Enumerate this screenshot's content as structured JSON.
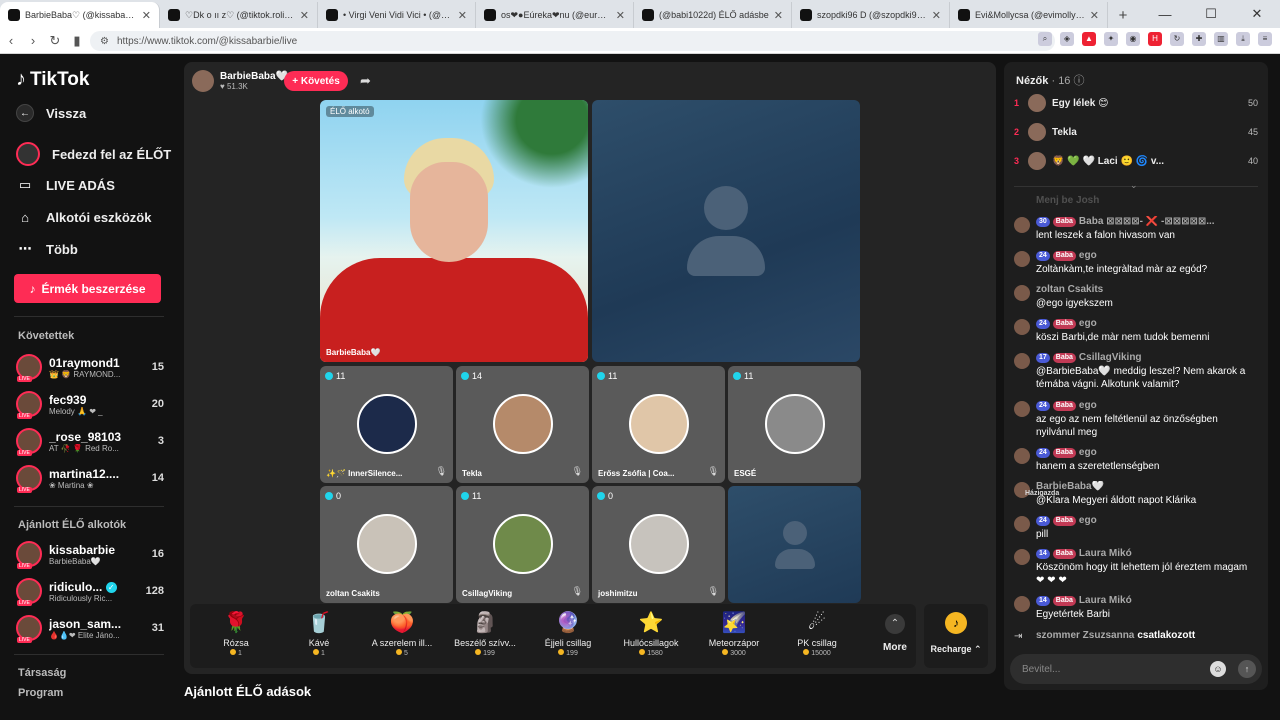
{
  "browser": {
    "tabs": [
      {
        "title": "BarbieBaba♡ (@kissabarbie",
        "active": true
      },
      {
        "title": "♡Dk o ıı z♡ (@tiktok.roli) ÉLŐ adás",
        "active": false
      },
      {
        "title": "• Virgi Veni Vidi Vici • (@virgiveni",
        "active": false
      },
      {
        "title": "os❤●Eúreka❤nu (@eurekaeurs",
        "active": false
      },
      {
        "title": "(@babi1022d) ÉLŐ adásbe",
        "active": false
      },
      {
        "title": "szopdki96 D (@szopdki96) ÉLŐ adás",
        "active": false
      },
      {
        "title": "Evi&Mollycsa (@evimolly2) ÉLŐ adás",
        "active": false
      }
    ],
    "url": "https://www.tiktok.com/@kissabarbie/live"
  },
  "sidebar": {
    "logo": "TikTok",
    "back": "Vissza",
    "explore": "Fedezd fel az ÉLŐT",
    "live": "LIVE ADÁS",
    "creator_tools": "Alkotói eszközök",
    "more": "Több",
    "coins_button": "Érmék beszerzése",
    "following_title": "Követettek",
    "following": [
      {
        "name": "01raymond1",
        "sub": "👑 🦁 RAYMOND...",
        "count": "15"
      },
      {
        "name": "fec939",
        "sub": "Melody 🙏 ❤ _",
        "count": "20"
      },
      {
        "name": "_rose_98103",
        "sub": "AT 🥀 🌹 Red Ro...",
        "count": "3"
      },
      {
        "name": "martina12....",
        "sub": "❀ Martina ❀",
        "count": "14"
      }
    ],
    "recommended_title": "Ajánlott ÉLŐ alkotók",
    "recommended": [
      {
        "name": "kissabarbie",
        "sub": "BarbieBaba🤍",
        "count": "16",
        "verified": false
      },
      {
        "name": "ridiculo...",
        "sub": "Ridiculously Ric...",
        "count": "128",
        "verified": true
      },
      {
        "name": "jason_sam...",
        "sub": "🩸💧❤ Elite Jáno...",
        "count": "31",
        "verified": false
      }
    ],
    "footer_links": [
      "Társaság",
      "Program"
    ]
  },
  "stream": {
    "host_name": "BarbieBaba🤍",
    "host_likes": "51.3K",
    "follow_label": "+ Követés",
    "main_badge": "ÉLŐ alkotó",
    "main_name": "BarbieBaba🤍",
    "tiles": [
      {
        "name": "✨🪄 InnerSilence...",
        "score": "11",
        "avatar_color": "#1c2a4a",
        "muted": true
      },
      {
        "name": "Tekla",
        "score": "14",
        "avatar_color": "#b58a6a",
        "muted": true
      },
      {
        "name": "Erőss Zsófia | Coa...",
        "score": "11",
        "avatar_color": "#e0c6a8",
        "muted": true
      },
      {
        "name": "ESGÉ",
        "score": "11",
        "avatar_color": "#8a8a8a",
        "muted": false
      },
      {
        "name": "zoltan Csakits",
        "score": "0",
        "avatar_color": "#c9c2b8",
        "muted": false
      },
      {
        "name": "CsillagViking",
        "score": "11",
        "avatar_color": "#6f8a4a",
        "muted": true
      },
      {
        "name": "joshimitzu",
        "score": "0",
        "avatar_color": "#c7c3bd",
        "muted": true
      }
    ],
    "gifts": [
      {
        "name": "Rózsa",
        "price": "1",
        "icon": "🌹"
      },
      {
        "name": "Kávé",
        "price": "1",
        "icon": "🥤"
      },
      {
        "name": "A szerelem ill...",
        "price": "5",
        "icon": "🍑"
      },
      {
        "name": "Beszélő szívv...",
        "price": "199",
        "icon": "🗿"
      },
      {
        "name": "Éjjeli csillag",
        "price": "199",
        "icon": "🔮"
      },
      {
        "name": "Hullócsillagok",
        "price": "1580",
        "icon": "⭐"
      },
      {
        "name": "Meteorzápor",
        "price": "3000",
        "icon": "🌠"
      },
      {
        "name": "PK csillag",
        "price": "15000",
        "icon": "☄"
      }
    ],
    "more_label": "More",
    "recharge_label": "Recharge ⌃",
    "below_title": "Ajánlott ÉLŐ adások"
  },
  "chat": {
    "viewers_label": "Nézők",
    "viewers_count": "· 16",
    "top_viewers": [
      {
        "rank": "1",
        "name": "Egy lélek 😊",
        "score": "50"
      },
      {
        "rank": "2",
        "name": "Tekla",
        "score": "45"
      },
      {
        "rank": "3",
        "name": "🦁 💚 🤍 Laci 🙂 🌀 v...",
        "score": "40"
      }
    ],
    "faded_line": "Menj be Josh",
    "messages": [
      {
        "user": "Baba ⊠⊠⊠⊠- ❌ -⊠⊠⊠⊠⊠...",
        "level": "30",
        "fan": "Baba",
        "text": "lent leszek a falon hivasom van"
      },
      {
        "user": "ego",
        "level": "24",
        "fan": "Baba",
        "text": "Zoltànkàm,te integràltad màr az egód?"
      },
      {
        "user": "zoltan Csakits",
        "level": "",
        "fan": "",
        "text": "@ego igyekszem"
      },
      {
        "user": "ego",
        "level": "24",
        "fan": "Baba",
        "text": "köszi Barbi,de màr nem tudok bemenni"
      },
      {
        "user": "CsillagViking",
        "level": "17",
        "fan": "Baba",
        "text": "@BarbieBaba🤍 meddig leszel? Nem akarok a témába vágni. Alkotunk valamit?"
      },
      {
        "user": "ego",
        "level": "24",
        "fan": "Baba",
        "text": "az ego az nem feltétlenül az önzőségben nyilvánul meg"
      },
      {
        "user": "ego",
        "level": "24",
        "fan": "Baba",
        "text": "hanem a szeretetlenségben"
      },
      {
        "user": "BarbieBaba🤍",
        "level": "",
        "fan": "",
        "host": "Házigazda",
        "text": "@Klara Megyeri áldott napot Klárika"
      },
      {
        "user": "ego",
        "level": "24",
        "fan": "Baba",
        "text": "pill"
      },
      {
        "user": "Laura Mikó",
        "level": "14",
        "fan": "Baba",
        "text": "Köszönöm hogy itt lehettem jól éreztem magam ❤ ❤ ❤"
      },
      {
        "user": "Laura Mikó",
        "level": "14",
        "fan": "Baba",
        "text": "Egyetértek Barbi"
      }
    ],
    "join_user": "szommer Zsuzsanna",
    "join_text": "csatlakozott",
    "input_placeholder": "Bevitel..."
  }
}
